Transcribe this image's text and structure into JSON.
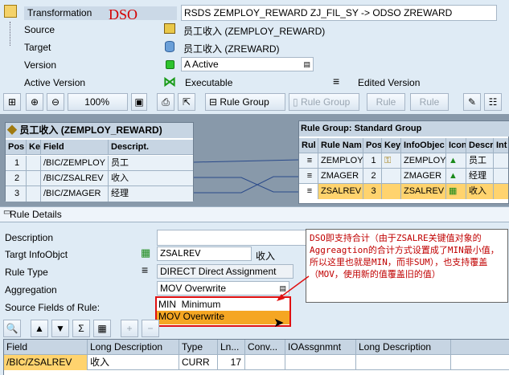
{
  "header": {
    "transformation_label": "Transformation",
    "transformation_value": "RSDS ZEMPLOY_REWARD ZJ_FIL_SY -> ODSO ZREWARD",
    "dso_annotation": "DSO",
    "source_label": "Source",
    "source_value": "员工收入 (ZEMPLOY_REWARD)",
    "target_label": "Target",
    "target_value": "员工收入 (ZREWARD)",
    "version_label": "Version",
    "version_value": "A Active",
    "active_version_label": "Active Version",
    "active_version_value": "Executable",
    "edited_version_label": "Edited Version"
  },
  "toolbar": {
    "zoom": "100%",
    "rule_group": "Rule Group",
    "rule_group_disabled": "Rule Group",
    "rule_1": "Rule",
    "rule_2": "Rule"
  },
  "source_table": {
    "title": "员工收入 (ZEMPLOY_REWARD)",
    "columns": [
      "Pos",
      "Ke",
      "Field",
      "Descript."
    ],
    "rows": [
      [
        "1",
        "",
        "/BIC/ZEMPLOY",
        "员工"
      ],
      [
        "2",
        "",
        "/BIC/ZSALREV",
        "收入"
      ],
      [
        "3",
        "",
        "/BIC/ZMAGER",
        "经理"
      ]
    ]
  },
  "target_table": {
    "title": "Rule Group: Standard Group",
    "columns": [
      "Rul",
      "Rule Nam",
      "Pos",
      "Key",
      "InfoObjec",
      "Icon",
      "Descr",
      "Int"
    ],
    "rows": [
      [
        "",
        "ZEMPLOY",
        "1",
        "",
        "ZEMPLOY",
        "",
        "员工",
        ""
      ],
      [
        "",
        "ZMAGER",
        "2",
        "",
        "ZMAGER",
        "",
        "经理",
        ""
      ],
      [
        "",
        "ZSALREV",
        "3",
        "",
        "ZSALREV",
        "",
        "收入",
        ""
      ]
    ]
  },
  "rule_details": {
    "title": "Rule Details",
    "description_label": "Description",
    "target_label": "Targt InfoObjct",
    "target_value": "ZSALREV",
    "target_desc": "收入",
    "rule_type_label": "Rule Type",
    "rule_type_value": "DIRECT Direct Assignment",
    "aggregation_label": "Aggregation",
    "aggregation_value": "MOV Overwrite",
    "source_fields_label": "Source Fields of Rule:",
    "dropdown_options": [
      "MIN  Minimum",
      "MOV Overwrite"
    ]
  },
  "annotation": {
    "text": "DSO即支持合计（由于ZSALRE关键值对象的Aggreagtion的合计方式设置成了MIN最小值，所以这里也就是MIN，而非SUM），也支持覆盖（MOV，使用新的值覆盖旧的值）"
  },
  "fields_table": {
    "columns": [
      "Field",
      "Long Description",
      "Type",
      "Ln...",
      "Conv...",
      "IOAssgnmnt",
      "Long Description"
    ],
    "rows": [
      [
        "/BIC/ZSALREV",
        "收入",
        "CURR",
        "17",
        "",
        "",
        ""
      ]
    ]
  }
}
